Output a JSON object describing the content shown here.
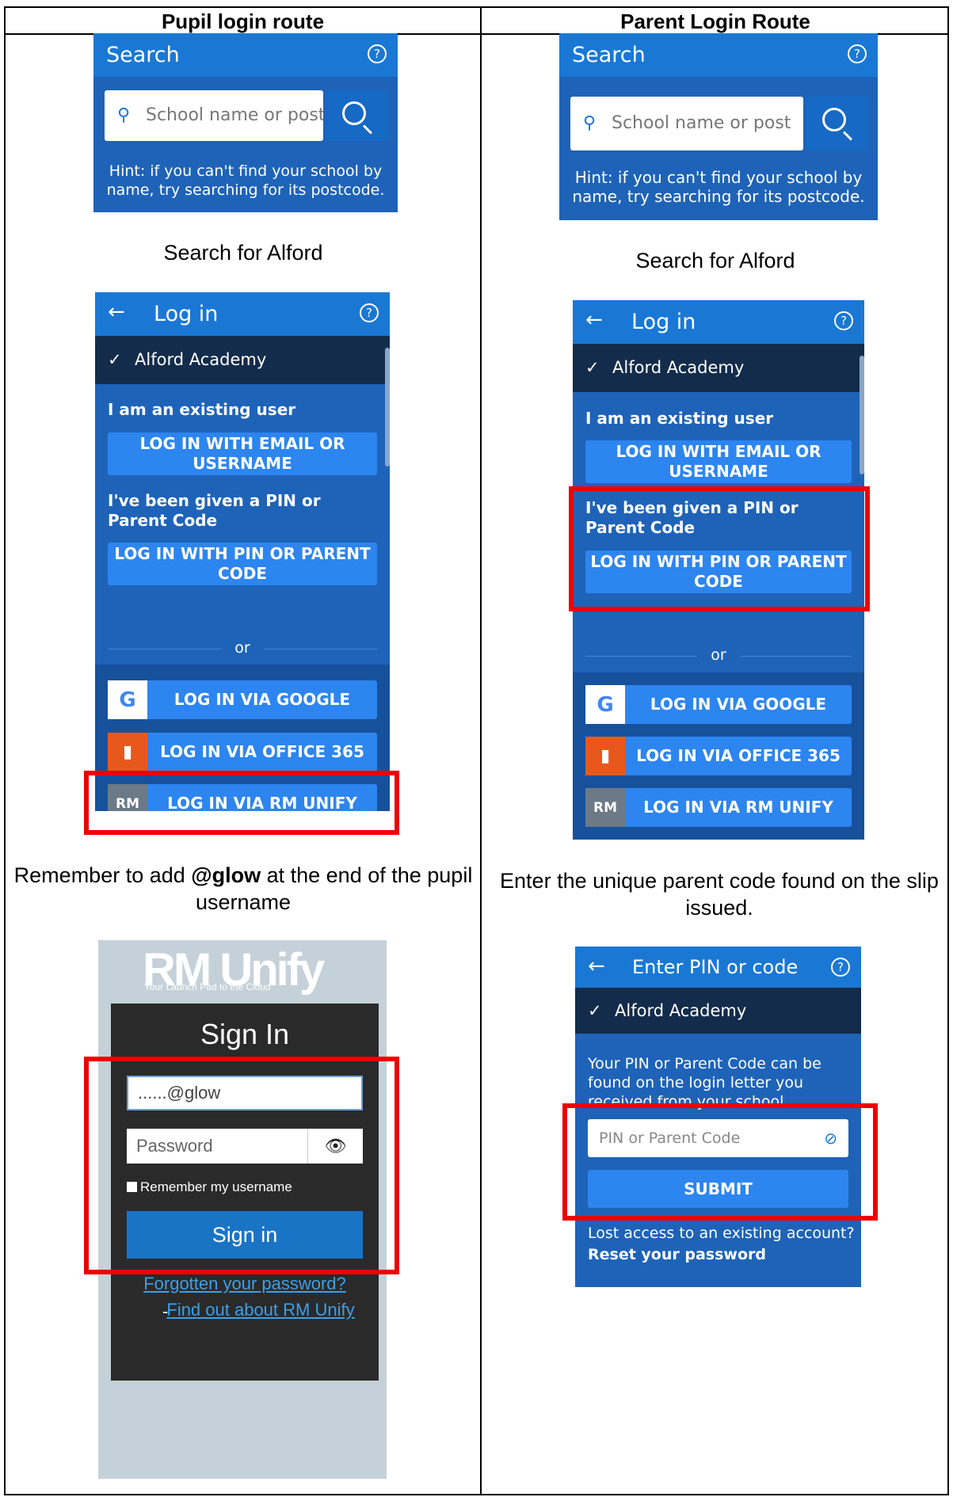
{
  "headers": {
    "left": "Pupil login route",
    "right": "Parent Login Route"
  },
  "search_panel": {
    "title": "Search",
    "help_icon": "?",
    "placeholder": "School name or post",
    "hint": "Hint: if you can't find your school by name, try searching for its postcode."
  },
  "captions": {
    "search_for": "Search for Alford",
    "pupil_note_pre": "Remember to add ",
    "pupil_note_bold": "@glow",
    "pupil_note_post": " at the end of the pupil username",
    "parent_note": "Enter the unique parent code found on the slip issued."
  },
  "login_panel": {
    "title": "Log in",
    "back_icon": "←",
    "school": "Alford Academy",
    "existing_user": "I am an existing user",
    "email_btn": "LOG IN WITH EMAIL OR USERNAME",
    "pin_label": "I've been given a PIN or Parent Code",
    "pin_btn": "LOG IN WITH PIN OR PARENT CODE",
    "or": "or",
    "google_btn": "LOG IN VIA GOOGLE",
    "office_btn": "LOG IN VIA OFFICE 365",
    "rm_btn": "LOG IN VIA RM UNIFY",
    "google_icon": "G",
    "rm_icon": "RM"
  },
  "rm_unify": {
    "logo": "RM Unify",
    "tagline": "Your Launch Pad to the Cloud",
    "title": "Sign In",
    "username_value": "......@glow",
    "password_placeholder": "Password",
    "remember": "Remember my username",
    "sign_in": "Sign in",
    "forgot": "Forgotten your password?",
    "separator": "-",
    "find_out": "Find out about RM Unify"
  },
  "pin_panel": {
    "title": "Enter PIN or code",
    "school": "Alford Academy",
    "info": "Your PIN or Parent Code can be found on the login letter you received from your school.",
    "input_placeholder": "PIN or Parent Code",
    "submit": "SUBMIT",
    "lost": "Lost access to an existing account?",
    "reset": "Reset your password"
  },
  "colors": {
    "accent": "#1a78d4",
    "panel": "#1e63b8",
    "highlight": "#e00000"
  }
}
